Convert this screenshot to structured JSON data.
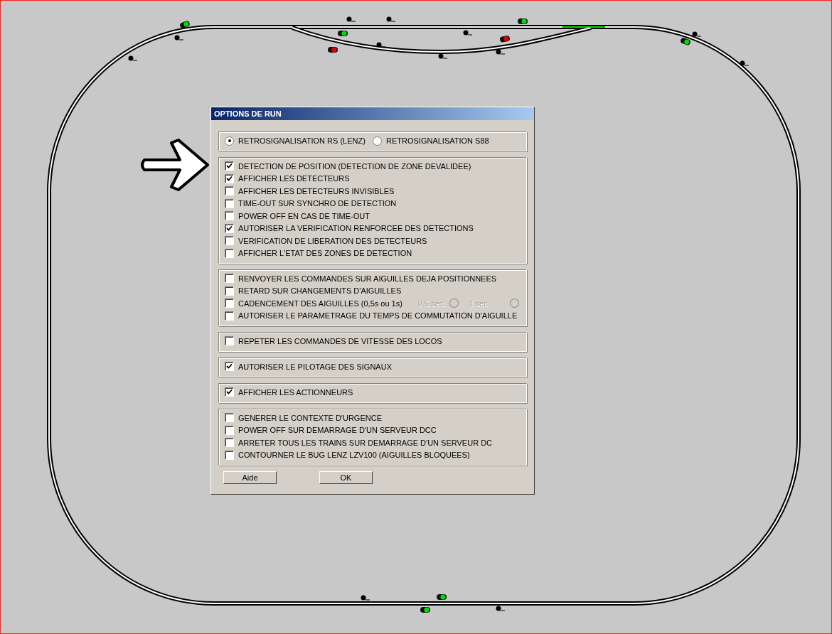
{
  "layout": {
    "signals": [
      {
        "color": "#00e000"
      },
      {
        "color": "#00e000"
      },
      {
        "color": "#e00000"
      },
      {
        "color": "#e00000"
      },
      {
        "color": "#00e000"
      },
      {
        "color": "#00e000"
      },
      {
        "color": "#00e000"
      },
      {
        "color": "#00e000"
      }
    ]
  },
  "dialog": {
    "title": "OPTIONS DE RUN",
    "groups": [
      {
        "kind": "radio",
        "options": [
          {
            "label": "RETROSIGNALISATION RS (LENZ)",
            "selected": true
          },
          {
            "label": "RETROSIGNALISATION S88",
            "selected": false
          }
        ]
      },
      {
        "kind": "checks",
        "items": [
          {
            "label": "DETECTION DE POSITION (DETECTION DE ZONE DEVALIDEE)",
            "checked": true
          },
          {
            "label": "AFFICHER LES DETECTEURS",
            "checked": true
          },
          {
            "label": "AFFICHER LES DETECTEURS INVISIBLES",
            "checked": false
          },
          {
            "label": "TIME-OUT SUR SYNCHRO DE DETECTION",
            "checked": false
          },
          {
            "label": "POWER OFF EN CAS DE TIME-OUT",
            "checked": false
          },
          {
            "label": "AUTORISER LA VERIFICATION RENFORCEE DES DETECTIONS",
            "checked": true
          },
          {
            "label": "VERIFICATION DE LIBERATION DES DETECTEURS",
            "checked": false
          },
          {
            "label": "AFFICHER L'ETAT DES ZONES DE DETECTION",
            "checked": false
          }
        ]
      },
      {
        "kind": "checks",
        "items": [
          {
            "label": "RENVOYER LES COMMANDES SUR AIGUILLES DEJA POSITIONNEES",
            "checked": false
          },
          {
            "label": "RETARD SUR CHANGEMENTS D'AIGUILLES",
            "checked": false
          },
          {
            "label": "CADENCEMENT DES AIGUILLES (0,5s ou 1s)",
            "checked": false,
            "sub_options": [
              {
                "label": "0.5 sec.",
                "selected": false,
                "disabled": true
              },
              {
                "label": "1 sec.",
                "selected": false,
                "disabled": true
              }
            ]
          },
          {
            "label": "AUTORISER LE PARAMETRAGE DU TEMPS DE COMMUTATION D'AIGUILLE",
            "checked": false
          }
        ]
      },
      {
        "kind": "checks",
        "items": [
          {
            "label": "REPETER LES COMMANDES DE VITESSE DES LOCOS",
            "checked": false
          }
        ]
      },
      {
        "kind": "checks",
        "items": [
          {
            "label": "AUTORISER LE PILOTAGE DES SIGNAUX",
            "checked": true
          }
        ]
      },
      {
        "kind": "checks",
        "items": [
          {
            "label": "AFFICHER LES ACTIONNEURS",
            "checked": true
          }
        ]
      },
      {
        "kind": "checks",
        "items": [
          {
            "label": "GENERER LE CONTEXTE D'URGENCE",
            "checked": false
          },
          {
            "label": "POWER OFF SUR DEMARRAGE D'UN SERVEUR DCC",
            "checked": false
          },
          {
            "label": "ARRETER TOUS LES TRAINS SUR DEMARRAGE D'UN SERVEUR DC",
            "checked": false
          },
          {
            "label": "CONTOURNER LE BUG LENZ LZV100 (AIGUILLES BLOQUEES)",
            "checked": false
          }
        ]
      }
    ],
    "buttons": [
      "Aide",
      "OK"
    ]
  }
}
